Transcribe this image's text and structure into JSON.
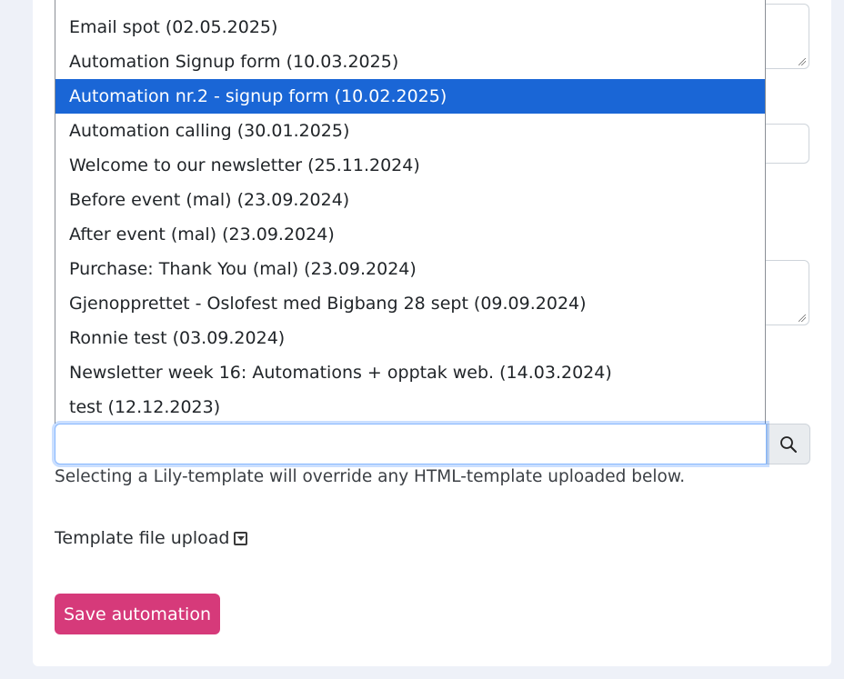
{
  "dropdown": {
    "selected_index": 2,
    "options": [
      "Email spot (02.05.2025)",
      "Automation Signup form (10.03.2025)",
      "Automation nr.2 - signup form (10.02.2025)",
      "Automation calling (30.01.2025)",
      "Welcome to our newsletter (25.11.2024)",
      "Before event (mal) (23.09.2024)",
      "After event (mal) (23.09.2024)",
      "Purchase: Thank You (mal) (23.09.2024)",
      "Gjenopprettet - Oslofest med Bigbang 28 sept (09.09.2024)",
      "Ronnie test (03.09.2024)",
      "Newsletter week 16: Automations + opptak web. (14.03.2024)",
      "test (12.12.2023)"
    ]
  },
  "template_search": {
    "value": "",
    "button_icon": "search-icon"
  },
  "help_text": "Selecting a Lily-template will override any HTML-template uploaded below.",
  "upload": {
    "label": "Template file upload",
    "toggle_icon": "caret-down-icon"
  },
  "save_button": {
    "label": "Save automation",
    "color": "#d63a7a"
  },
  "colors": {
    "selected_option": "#1a66d6",
    "focus_border": "#86b7fe"
  }
}
